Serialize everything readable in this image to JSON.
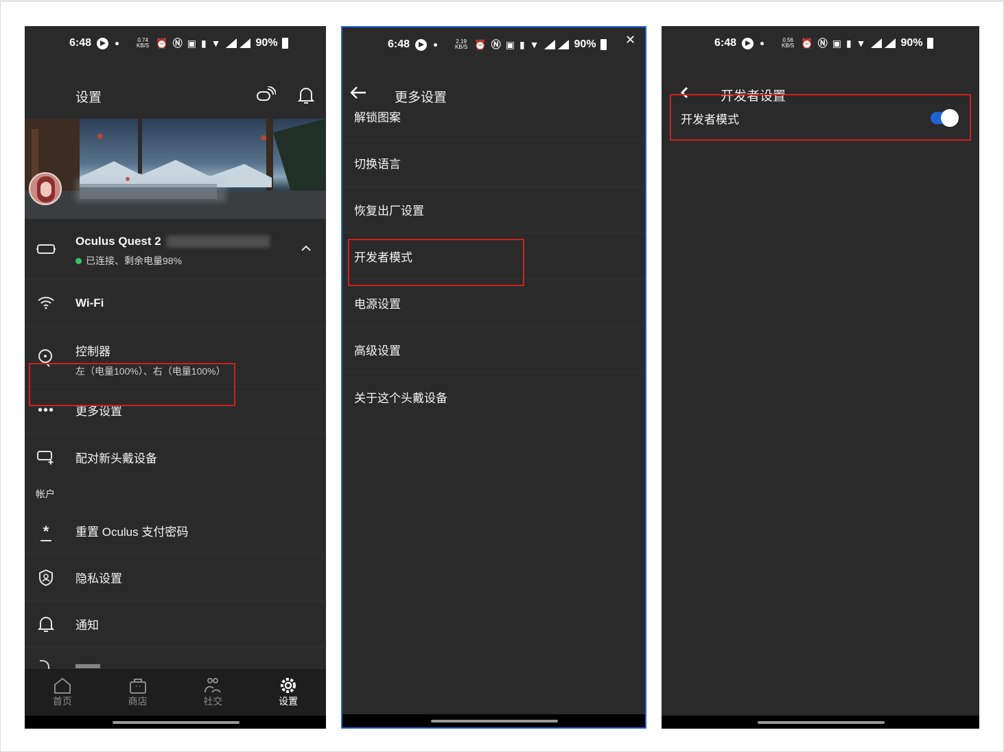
{
  "status_left": {
    "time": "6:48",
    "kbs": "0.74",
    "kbs_unit": "KB/S",
    "battery": "90%"
  },
  "status_mid": {
    "time": "6:48",
    "kbs": "2.19",
    "kbs_unit": "KB/S",
    "battery": "90%"
  },
  "status_right": {
    "time": "6:48",
    "kbs": "0.56",
    "kbs_unit": "KB/S",
    "battery": "90%"
  },
  "settings_screen": {
    "title": "设置",
    "device": {
      "name": "Oculus Quest 2",
      "status": "已连接、剩余电量98%"
    },
    "items": [
      {
        "label": "Wi-Fi",
        "icon": "wifi-icon"
      },
      {
        "label": "控制器",
        "sub": "左（电量100%）、右（电量100%）",
        "icon": "controller-icon"
      },
      {
        "label": "更多设置",
        "icon": "more-icon"
      },
      {
        "label": "配对新头戴设备",
        "icon": "pair-headset-icon"
      }
    ],
    "section_account": "帐户",
    "account_items": [
      {
        "label": "重置 Oculus 支付密码",
        "icon": "password-icon"
      },
      {
        "label": "隐私设置",
        "icon": "privacy-shield-icon"
      },
      {
        "label": "通知",
        "icon": "bell-icon"
      }
    ],
    "nav": [
      {
        "label": "首页",
        "icon": "home-icon"
      },
      {
        "label": "商店",
        "icon": "store-icon"
      },
      {
        "label": "社交",
        "icon": "social-icon"
      },
      {
        "label": "设置",
        "icon": "settings-gear-icon"
      }
    ],
    "accent_green": "#34c759"
  },
  "more_settings_screen": {
    "title": "更多设置",
    "items": [
      "解锁图案",
      "切换语言",
      "恢复出厂设置",
      "开发者模式",
      "电源设置",
      "高级设置",
      "关于这个头戴设备"
    ]
  },
  "developer_screen": {
    "title": "开发者设置",
    "toggle_label": "开发者模式",
    "toggle_on": true,
    "toggle_color": "#1e63d6"
  },
  "highlight_color": "#d0201c",
  "active_panel_border": "#1e63d6"
}
